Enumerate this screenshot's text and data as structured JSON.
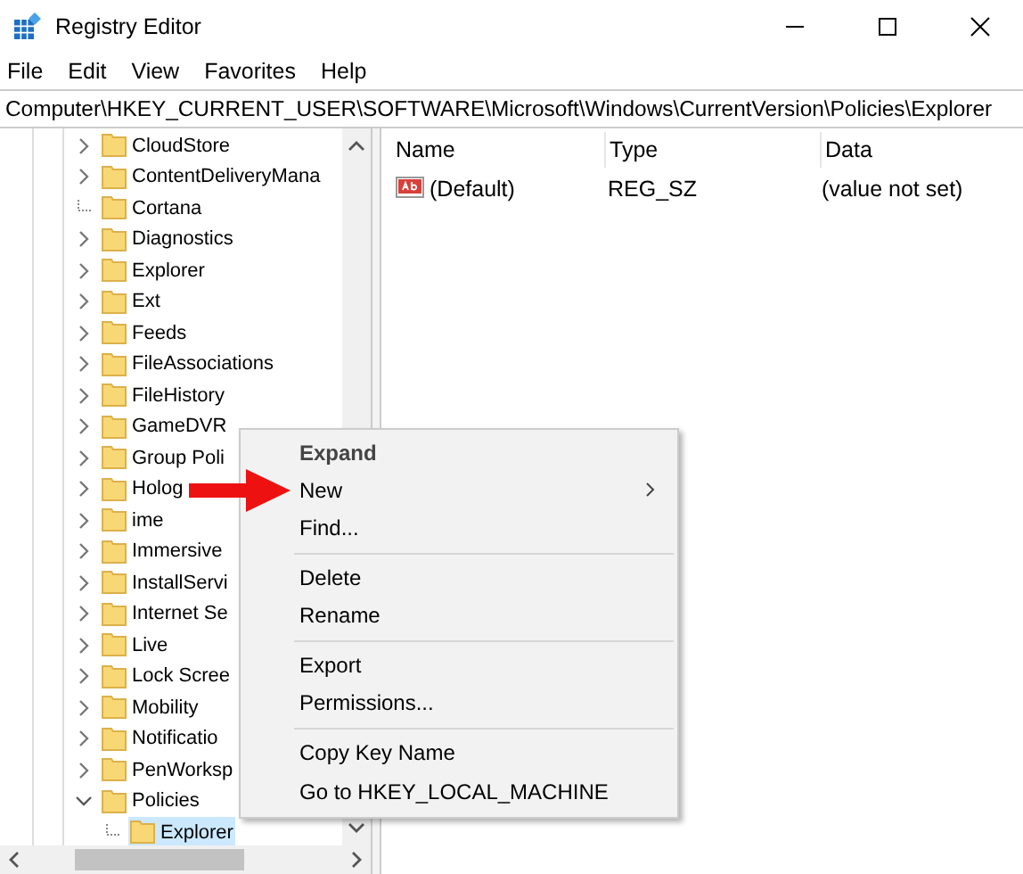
{
  "window": {
    "title": "Registry Editor"
  },
  "menu": [
    {
      "label": "File"
    },
    {
      "label": "Edit"
    },
    {
      "label": "View"
    },
    {
      "label": "Favorites"
    },
    {
      "label": "Help"
    }
  ],
  "address": "Computer\\HKEY_CURRENT_USER\\SOFTWARE\\Microsoft\\Windows\\CurrentVersion\\Policies\\Explorer",
  "tree": [
    {
      "label": "CloudStore",
      "expanded": false,
      "selected": false
    },
    {
      "label": "ContentDeliveryMana",
      "expanded": false,
      "selected": false
    },
    {
      "label": "Cortana",
      "selected": false
    },
    {
      "label": "Diagnostics",
      "expanded": false,
      "selected": false
    },
    {
      "label": "Explorer",
      "expanded": false,
      "selected": false
    },
    {
      "label": "Ext",
      "expanded": false,
      "selected": false
    },
    {
      "label": "Feeds",
      "expanded": false,
      "selected": false
    },
    {
      "label": "FileAssociations",
      "expanded": false,
      "selected": false
    },
    {
      "label": "FileHistory",
      "expanded": false,
      "selected": false
    },
    {
      "label": "GameDVR",
      "expanded": false,
      "selected": false
    },
    {
      "label": "Group Poli",
      "expanded": false,
      "selected": false
    },
    {
      "label": "Holog",
      "expanded": false,
      "selected": false
    },
    {
      "label": "ime",
      "expanded": false,
      "selected": false
    },
    {
      "label": "Immersive",
      "expanded": false,
      "selected": false
    },
    {
      "label": "InstallServi",
      "expanded": false,
      "selected": false
    },
    {
      "label": "Internet Se",
      "expanded": false,
      "selected": false
    },
    {
      "label": "Live",
      "expanded": false,
      "selected": false
    },
    {
      "label": "Lock Scree",
      "expanded": false,
      "selected": false
    },
    {
      "label": "Mobility",
      "expanded": false,
      "selected": false
    },
    {
      "label": "Notificatio",
      "expanded": false,
      "selected": false
    },
    {
      "label": "PenWorksp",
      "expanded": false,
      "selected": false
    },
    {
      "label": "Policies",
      "expanded": true,
      "selected": false,
      "children": [
        {
          "label": "Explorer",
          "selected": true
        }
      ]
    }
  ],
  "values": {
    "columns": [
      "Name",
      "Type",
      "Data"
    ],
    "rows": [
      {
        "name": "(Default)",
        "type": "REG_SZ",
        "data": "(value not set)"
      }
    ]
  },
  "context_menu": {
    "groups": [
      [
        {
          "label": "Expand",
          "default": true,
          "submenu": false
        },
        {
          "label": "New",
          "default": false,
          "submenu": true
        },
        {
          "label": "Find...",
          "default": false,
          "submenu": false
        }
      ],
      [
        {
          "label": "Delete",
          "default": false,
          "submenu": false
        },
        {
          "label": "Rename",
          "default": false,
          "submenu": false
        }
      ],
      [
        {
          "label": "Export",
          "default": false,
          "submenu": false
        },
        {
          "label": "Permissions...",
          "default": false,
          "submenu": false
        }
      ],
      [
        {
          "label": "Copy Key Name",
          "default": false,
          "submenu": false
        },
        {
          "label": "Go to HKEY_LOCAL_MACHINE",
          "default": false,
          "submenu": false
        }
      ]
    ]
  }
}
